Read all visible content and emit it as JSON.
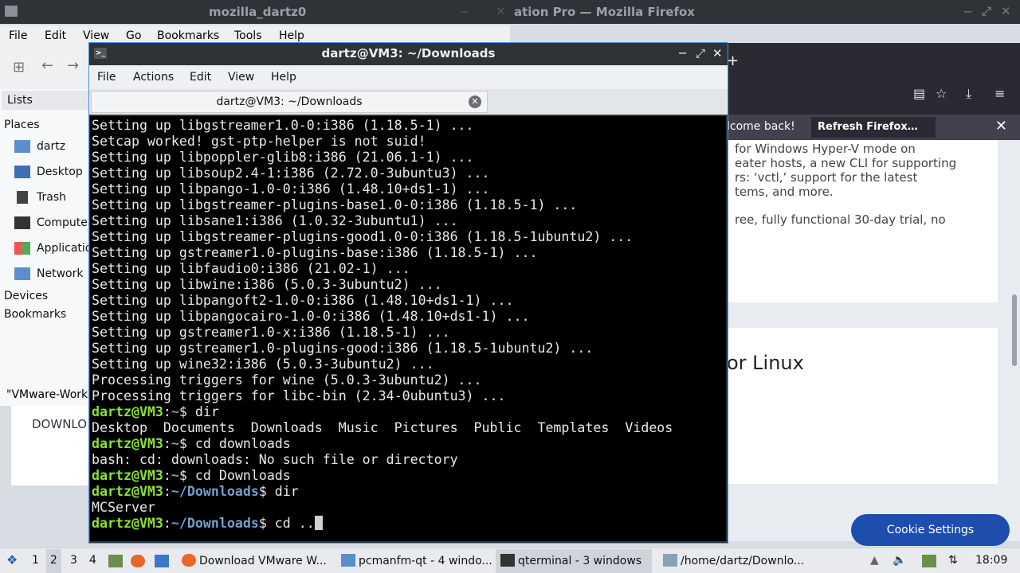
{
  "firefox": {
    "title_left": "mozilla_dartz0",
    "title_right": "ation Pro — Mozilla Firefox",
    "welcome_back": "lcome back!",
    "refresh_label": "Refresh Firefox…",
    "card1_lines": [
      "for Windows Hyper-V mode on",
      "eater hosts, a new CLI for supporting",
      "rs: ‘vctl,’ support for the latest",
      "tems, and more.",
      "ree, fully functional 30-day trial, no"
    ],
    "card2_heading": "or Linux",
    "download_text": "DOWNLO",
    "cookie_label": "Cookie Settings"
  },
  "file_manager": {
    "menu": [
      "File",
      "Edit",
      "View",
      "Go",
      "Bookmarks",
      "Tools",
      "Help"
    ],
    "lists_label": "Lists",
    "places_label": "Places",
    "places": [
      "dartz",
      "Desktop",
      "Trash",
      "Computer",
      "Applications",
      "Network"
    ],
    "devices_label": "Devices",
    "bookmarks_label": "Bookmarks",
    "status": "\"VMware-Work"
  },
  "terminal": {
    "title": "dartz@VM3: ~/Downloads",
    "menu": [
      "File",
      "Actions",
      "Edit",
      "View",
      "Help"
    ],
    "tab_label": "dartz@VM3: ~/Downloads",
    "prompt_user": "dartz@VM3",
    "lines": [
      "Setting up libgstreamer1.0-0:i386 (1.18.5-1) ...",
      "Setcap worked! gst-ptp-helper is not suid!",
      "Setting up libpoppler-glib8:i386 (21.06.1-1) ...",
      "Setting up libsoup2.4-1:i386 (2.72.0-3ubuntu3) ...",
      "Setting up libpango-1.0-0:i386 (1.48.10+ds1-1) ...",
      "Setting up libgstreamer-plugins-base1.0-0:i386 (1.18.5-1) ...",
      "Setting up libsane1:i386 (1.0.32-3ubuntu1) ...",
      "Setting up libgstreamer-plugins-good1.0-0:i386 (1.18.5-1ubuntu2) ...",
      "Setting up gstreamer1.0-plugins-base:i386 (1.18.5-1) ...",
      "Setting up libfaudio0:i386 (21.02-1) ...",
      "Setting up libwine:i386 (5.0.3-3ubuntu2) ...",
      "Setting up libpangoft2-1.0-0:i386 (1.48.10+ds1-1) ...",
      "Setting up libpangocairo-1.0-0:i386 (1.48.10+ds1-1) ...",
      "Setting up gstreamer1.0-x:i386 (1.18.5-1) ...",
      "Setting up gstreamer1.0-plugins-good:i386 (1.18.5-1ubuntu2) ...",
      "Setting up wine32:i386 (5.0.3-3ubuntu2) ...",
      "Processing triggers for wine (5.0.3-3ubuntu2) ...",
      "Processing triggers for libc-bin (2.34-0ubuntu3) ..."
    ],
    "session": [
      {
        "dir": "~",
        "cmd": " dir"
      },
      {
        "out": "Desktop  Documents  Downloads  Music  Pictures  Public  Templates  Videos"
      },
      {
        "dir": "~",
        "cmd": " cd downloads"
      },
      {
        "out": "bash: cd: downloads: No such file or directory"
      },
      {
        "dir": "~",
        "cmd": " cd Downloads"
      },
      {
        "dir": "~/Downloads",
        "cmd": " dir"
      },
      {
        "out": "MCServer"
      },
      {
        "dir": "~/Downloads",
        "cmd": " cd ..",
        "cursor": true
      }
    ]
  },
  "taskbar": {
    "workspaces": [
      "1",
      "2",
      "3",
      "4"
    ],
    "tasks": [
      "Download VMware W...",
      "pcmanfm-qt - 4 windo...",
      "qterminal - 3 windows",
      "/home/dartz/Downlo..."
    ],
    "clock": "18:09"
  }
}
